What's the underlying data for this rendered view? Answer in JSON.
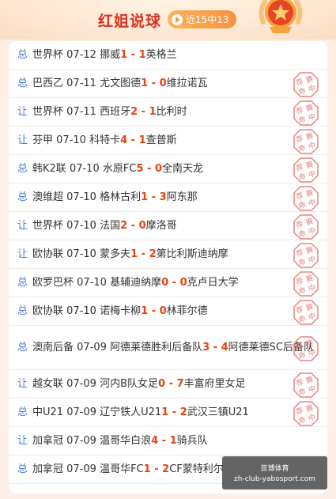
{
  "header": {
    "title": "红姐说球",
    "record_label": "近15中13"
  },
  "colors": {
    "accent_red": "#d9321f",
    "score_red": "#e8420f",
    "type_blue": "#4a7ce0",
    "stamp_red": "#e25a5a",
    "pill_orange": "#f7923e"
  },
  "stamp_text": [
    "荐",
    "赛",
    "命",
    "中"
  ],
  "matches": [
    {
      "type": "总",
      "league": "世界杯",
      "date": "07-12",
      "home": "挪威",
      "score_home": "1",
      "sep": " - ",
      "score_away": "1",
      "away": "英格兰",
      "hit": false
    },
    {
      "type": "总",
      "league": "巴西乙",
      "date": "07-11",
      "home": "尤文图德",
      "score_home": "1",
      "sep": " - ",
      "score_away": "0",
      "away": "维拉诺瓦",
      "hit": true
    },
    {
      "type": "让",
      "league": "世界杯",
      "date": "07-11",
      "home": "西班牙",
      "score_home": "2",
      "sep": " - ",
      "score_away": "1",
      "away": "比利时",
      "hit": true
    },
    {
      "type": "让",
      "league": "芬甲",
      "date": "07-10",
      "home": "科特卡",
      "score_home": "4",
      "sep": " - ",
      "score_away": "1",
      "away": "查普斯",
      "hit": true
    },
    {
      "type": "总",
      "league": "韩K2联",
      "date": "07-10",
      "home": "水原FC",
      "score_home": "5",
      "sep": " - ",
      "score_away": "0",
      "away": "全南天龙",
      "hit": true
    },
    {
      "type": "总",
      "league": "澳维超",
      "date": "07-10",
      "home": "格林古利",
      "score_home": "1",
      "sep": " - ",
      "score_away": "3",
      "away": "阿东那",
      "hit": true
    },
    {
      "type": "让",
      "league": "世界杯",
      "date": "07-10",
      "home": "法国",
      "score_home": "2",
      "sep": " - ",
      "score_away": "0",
      "away": "摩洛哥",
      "hit": true
    },
    {
      "type": "让",
      "league": "欧协联",
      "date": "07-10",
      "home": "蒙多夫",
      "score_home": "1",
      "sep": " - ",
      "score_away": "2",
      "away": "第比利斯迪纳摩",
      "hit": true
    },
    {
      "type": "总",
      "league": "欧罗巴杯",
      "date": "07-10",
      "home": "基辅迪纳摩",
      "score_home": "0",
      "sep": " - ",
      "score_away": "0",
      "away": "克卢日大学",
      "hit": true
    },
    {
      "type": "总",
      "league": "欧协联",
      "date": "07-10",
      "home": "诺梅卡柳",
      "score_home": "1",
      "sep": " - ",
      "score_away": "0",
      "away": "林菲尔德",
      "hit": true
    },
    {
      "type": "总",
      "league": "澳南后备",
      "date": "07-09",
      "home": "阿德莱德胜利后备队",
      "score_home": "3",
      "sep": " - ",
      "score_away": "4",
      "away": "阿德莱德SC后备队",
      "hit": true
    },
    {
      "type": "让",
      "league": "越女联",
      "date": "07-09",
      "home": "河内B队女足",
      "score_home": "0",
      "sep": " - ",
      "score_away": "7",
      "away": "丰富府里女足",
      "hit": true
    },
    {
      "type": "总",
      "league": "中U21",
      "date": "07-09",
      "home": "辽宁铁人U21",
      "score_home": "1",
      "sep": " - ",
      "score_away": "2",
      "away": "武汉三镇U21",
      "hit": true
    },
    {
      "type": "让",
      "league": "加拿冠",
      "date": "07-09",
      "home": "温哥华白浪",
      "score_home": "4",
      "sep": " - ",
      "score_away": "1",
      "away": "骑兵队",
      "hit": false
    },
    {
      "type": "总",
      "league": "加拿冠",
      "date": "07-09",
      "home": "温哥华FC",
      "score_home": "1",
      "sep": " - ",
      "score_away": "2",
      "away": "CF蒙特利尔",
      "hit": false
    }
  ],
  "watermark": {
    "line1": "亚博体育",
    "line2": "zh-club-yabosport.com"
  }
}
